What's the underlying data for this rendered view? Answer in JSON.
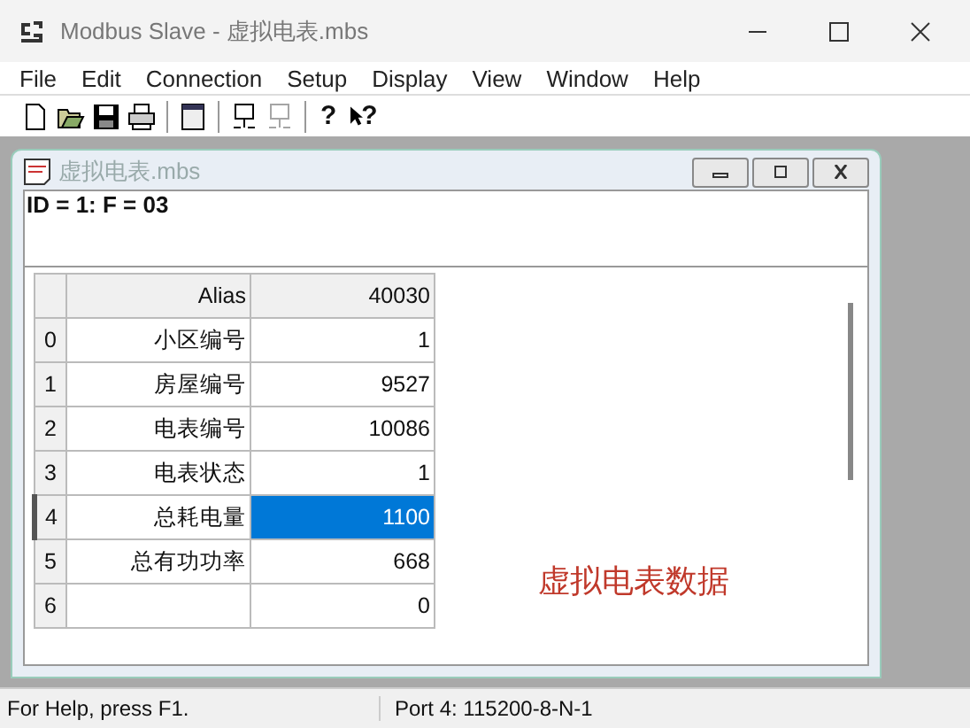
{
  "window": {
    "title": "Modbus Slave - 虚拟电表.mbs"
  },
  "menu": [
    "File",
    "Edit",
    "Connection",
    "Setup",
    "Display",
    "View",
    "Window",
    "Help"
  ],
  "toolbar": [
    {
      "kind": "new",
      "disabled": false
    },
    {
      "kind": "open",
      "disabled": false
    },
    {
      "kind": "save",
      "disabled": false
    },
    {
      "kind": "print",
      "disabled": false
    },
    {
      "kind": "separator"
    },
    {
      "kind": "window",
      "disabled": false
    },
    {
      "kind": "separator"
    },
    {
      "kind": "connect",
      "disabled": false
    },
    {
      "kind": "disconnect",
      "disabled": true
    },
    {
      "kind": "separator"
    },
    {
      "kind": "help",
      "glyph": "?",
      "disabled": false
    },
    {
      "kind": "context-help",
      "glyph": "?",
      "disabled": false
    }
  ],
  "child_window": {
    "title": "虚拟电表.mbs",
    "info": "ID = 1: F = 03",
    "table": {
      "columns": [
        "Alias",
        "40030"
      ],
      "rows": [
        {
          "index": "0",
          "alias": "小区编号",
          "value": "1",
          "selected": false
        },
        {
          "index": "1",
          "alias": "房屋编号",
          "value": "9527",
          "selected": false
        },
        {
          "index": "2",
          "alias": "电表编号",
          "value": "10086",
          "selected": false
        },
        {
          "index": "3",
          "alias": "电表状态",
          "value": "1",
          "selected": false
        },
        {
          "index": "4",
          "alias": "总耗电量",
          "value": "1100",
          "selected": true
        },
        {
          "index": "5",
          "alias": "总有功功率",
          "value": "668",
          "selected": false
        },
        {
          "index": "6",
          "alias": "",
          "value": "0",
          "selected": false
        }
      ]
    },
    "annotation": "虚拟电表数据"
  },
  "status_bar": [
    "For Help, press F1.",
    "Port 4: 115200-8-N-1"
  ]
}
